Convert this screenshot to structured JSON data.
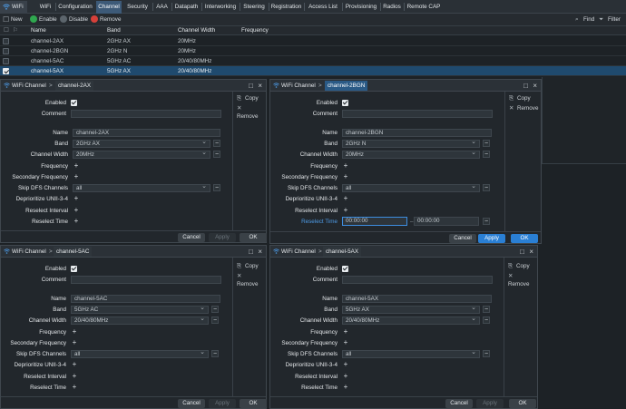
{
  "tabs": [
    "WiFi",
    "WiFi",
    "Configuration",
    "Channel",
    "Security",
    "AAA",
    "Datapath",
    "Interworking",
    "Steering",
    "Registration",
    "Access List",
    "Provisioning",
    "Radios",
    "Remote CAP"
  ],
  "toolbar": {
    "new": "New",
    "enable": "Enable",
    "disable": "Disable",
    "remove": "Remove",
    "find": "Find",
    "filter": "Filter"
  },
  "table": {
    "headers": {
      "name": "Name",
      "band": "Band",
      "width": "Channel Width",
      "freq": "Frequency"
    },
    "rows": [
      {
        "name": "channel-2AX",
        "band": "2GHz AX",
        "width": "20MHz"
      },
      {
        "name": "channel-2BGN",
        "band": "2GHz N",
        "width": "20MHz"
      },
      {
        "name": "channel-5AC",
        "band": "5GHz AC",
        "width": "20/40/80MHz"
      },
      {
        "name": "channel-5AX",
        "band": "5GHz AX",
        "width": "20/40/80MHz"
      }
    ]
  },
  "dialog": {
    "title": "WiFi Channel",
    "labels": {
      "enabled": "Enabled",
      "comment": "Comment",
      "name": "Name",
      "band": "Band",
      "width": "Channel Width",
      "freq": "Frequency",
      "sec_freq": "Secondary Frequency",
      "skip_dfs": "Skip DFS Channels",
      "deprioritize": "Deprioritize UNII-3-4",
      "reselect_interval": "Reselect Interval",
      "reselect_time": "Reselect Time"
    },
    "side": {
      "copy": "Copy",
      "remove": "Remove"
    },
    "buttons": {
      "cancel": "Cancel",
      "apply": "Apply",
      "ok": "OK"
    },
    "skip_value": "all"
  },
  "dialogs": [
    {
      "crumb": "channel-2AX",
      "name": "channel-2AX",
      "band": "2GHz AX",
      "width": "20MHz"
    },
    {
      "crumb": "channel-2BGN",
      "name": "channel-2BGN",
      "band": "2GHz N",
      "width": "20MHz",
      "reselect_from": "00:00:00",
      "reselect_to": "00:00:00"
    },
    {
      "crumb": "channel-5AC",
      "name": "channel-5AC",
      "band": "5GHz AC",
      "width": "20/40/80MHz"
    },
    {
      "crumb": "channel-5AX",
      "name": "channel-5AX",
      "band": "5GHz AX",
      "width": "20/40/80MHz"
    }
  ]
}
